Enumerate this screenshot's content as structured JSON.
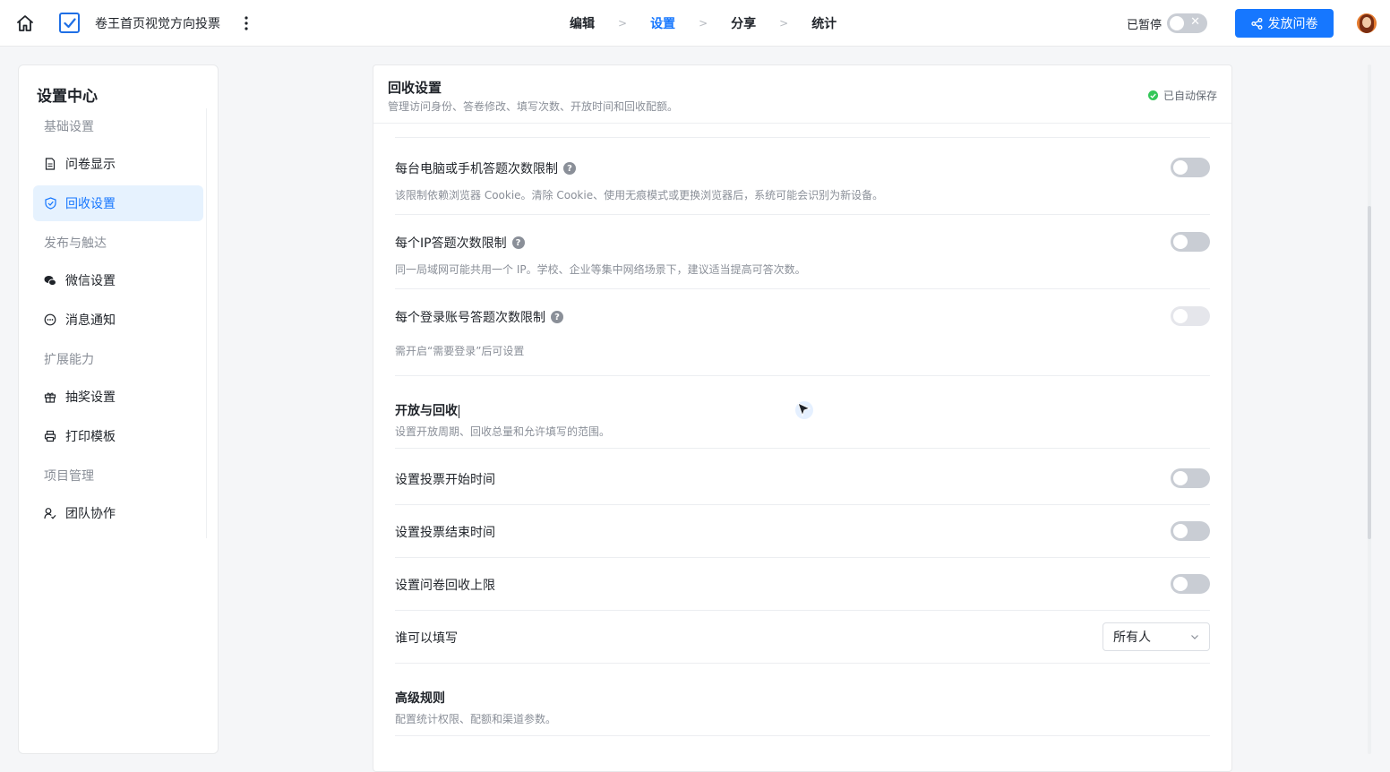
{
  "topbar": {
    "title": "卷王首页视觉方向投票",
    "steps": [
      {
        "label": "编辑",
        "active": false
      },
      {
        "label": "设置",
        "active": true
      },
      {
        "label": "分享",
        "active": false
      },
      {
        "label": "统计",
        "active": false
      }
    ],
    "pause_label": "已暂停",
    "publish_label": "发放问卷"
  },
  "sidebar": {
    "title": "设置中心",
    "groups": [
      "基础设置",
      "发布与触达",
      "扩展能力",
      "项目管理"
    ],
    "items": [
      {
        "label": "问卷显示",
        "icon": "document-icon"
      },
      {
        "label": "回收设置",
        "icon": "shield-check-icon",
        "active": true
      },
      {
        "label": "微信设置",
        "icon": "wechat-icon"
      },
      {
        "label": "消息通知",
        "icon": "message-icon"
      },
      {
        "label": "抽奖设置",
        "icon": "gift-icon"
      },
      {
        "label": "打印模板",
        "icon": "printer-icon"
      },
      {
        "label": "团队协作",
        "icon": "team-icon"
      }
    ]
  },
  "panel": {
    "title": "回收设置",
    "subtitle": "管理访问身份、答卷修改、填写次数、开放时间和回收配额。",
    "autosave": "已自动保存",
    "limits": [
      {
        "label": "每台电脑或手机答题次数限制",
        "desc": "该限制依赖浏览器 Cookie。清除 Cookie、使用无痕模式或更换浏览器后，系统可能会识别为新设备。",
        "enabled": false
      },
      {
        "label": "每个IP答题次数限制",
        "desc": "同一局域网可能共用一个 IP。学校、企业等集中网络场景下，建议适当提高可答次数。",
        "enabled": false
      },
      {
        "label": "每个登录账号答题次数限制",
        "desc": "需开启“需要登录”后可设置",
        "enabled": false,
        "disabled": true
      }
    ],
    "open_section": {
      "title": "开放与回收",
      "desc": "设置开放周期、回收总量和允许填写的范围。"
    },
    "open_settings": [
      {
        "label": "设置投票开始时间",
        "enabled": false
      },
      {
        "label": "设置投票结束时间",
        "enabled": false
      },
      {
        "label": "设置问卷回收上限",
        "enabled": false
      }
    ],
    "who_can_fill": {
      "label": "谁可以填写",
      "value": "所有人"
    },
    "advanced_section": {
      "title": "高级规则",
      "desc": "配置统计权限、配额和渠道参数。"
    }
  },
  "colors": {
    "accent": "#1677ff",
    "active_bg": "#e6f2fe",
    "toggle_off": "#c9cdd4",
    "success": "#34c759"
  }
}
